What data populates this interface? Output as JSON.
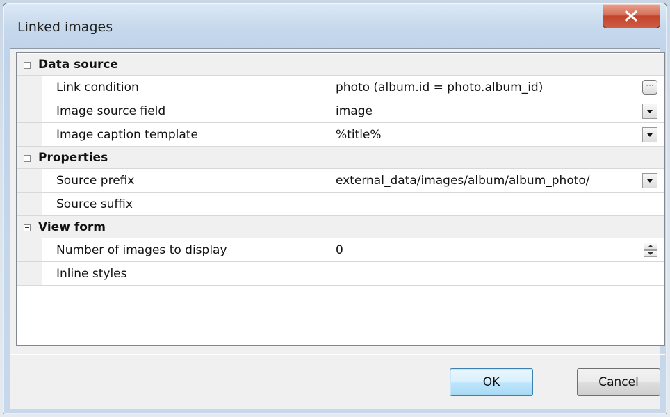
{
  "window": {
    "title": "Linked images"
  },
  "grid": {
    "categories": [
      {
        "label": "Data source",
        "rows": [
          {
            "name": "Link condition",
            "value": "photo (album.id = photo.album_id)",
            "editor": "ellipsis"
          },
          {
            "name": "Image source field",
            "value": "image",
            "editor": "dropdown"
          },
          {
            "name": "Image caption template",
            "value": "%title%",
            "editor": "dropdown"
          }
        ]
      },
      {
        "label": "Properties",
        "rows": [
          {
            "name": "Source prefix",
            "value": "external_data/images/album/album_photo/",
            "editor": "dropdown"
          },
          {
            "name": "Source suffix",
            "value": "",
            "editor": "none"
          }
        ]
      },
      {
        "label": "View form",
        "rows": [
          {
            "name": "Number of images to display",
            "value": "0",
            "editor": "spinner"
          },
          {
            "name": "Inline styles",
            "value": "",
            "editor": "none"
          }
        ]
      }
    ],
    "ellipsis_glyph": "···"
  },
  "buttons": {
    "ok": "OK",
    "cancel": "Cancel"
  },
  "icons": {
    "close": "close-icon",
    "collapse": "collapse-minus-icon"
  },
  "colors": {
    "close_button": "#c2432a",
    "ok_button_border": "#3c7fb1"
  }
}
